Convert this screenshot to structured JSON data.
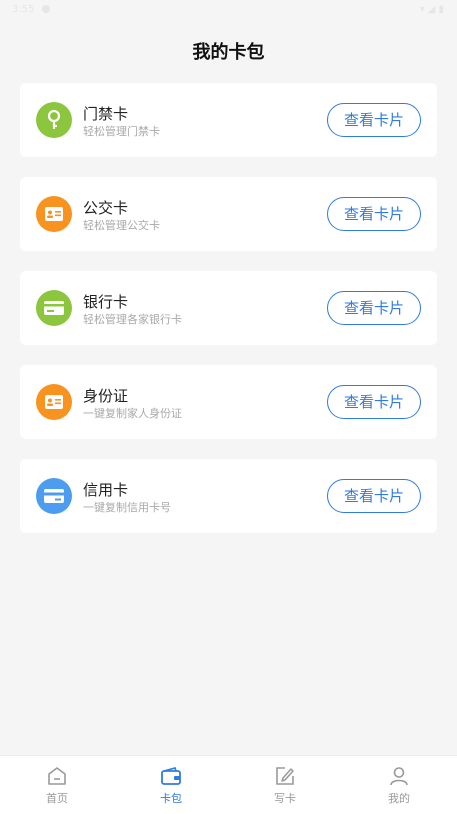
{
  "status_bar": {
    "time": "3:55"
  },
  "page_title": "我的卡包",
  "cards": [
    {
      "name": "门禁卡",
      "desc": "轻松管理门禁卡",
      "button": "查看卡片",
      "icon": "key-icon",
      "color": "#8cc63f"
    },
    {
      "name": "公交卡",
      "desc": "轻松管理公交卡",
      "button": "查看卡片",
      "icon": "id-card-icon",
      "color": "#f7931e"
    },
    {
      "name": "银行卡",
      "desc": "轻松管理各家银行卡",
      "button": "查看卡片",
      "icon": "bank-card-icon",
      "color": "#8cc63f"
    },
    {
      "name": "身份证",
      "desc": "一键复制家人身份证",
      "button": "查看卡片",
      "icon": "id-card-icon",
      "color": "#f7931e"
    },
    {
      "name": "信用卡",
      "desc": "一键复制信用卡号",
      "button": "查看卡片",
      "icon": "credit-card-icon",
      "color": "#4c9cf0"
    }
  ],
  "tabbar": {
    "items": [
      {
        "label": "首页",
        "icon": "home-icon"
      },
      {
        "label": "卡包",
        "icon": "wallet-icon",
        "active": true
      },
      {
        "label": "写卡",
        "icon": "edit-icon"
      },
      {
        "label": "我的",
        "icon": "user-icon"
      }
    ]
  },
  "colors": {
    "accent": "#2f7be0",
    "background": "#f5f5f5"
  }
}
